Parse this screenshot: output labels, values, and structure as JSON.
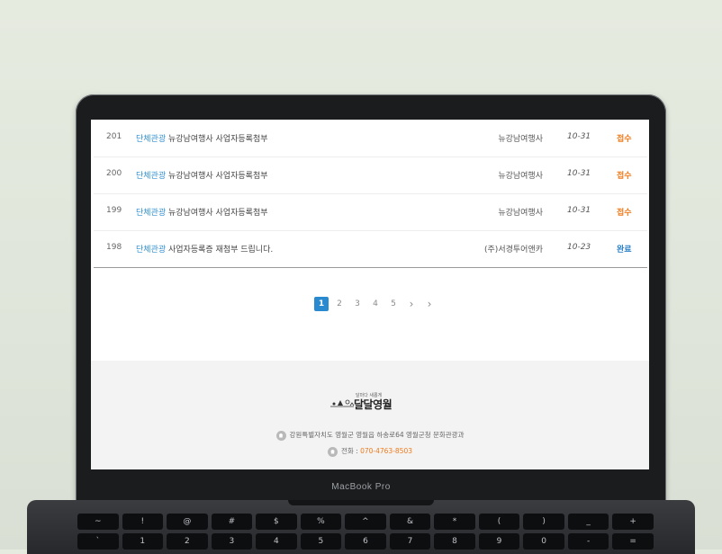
{
  "board": {
    "rows": [
      {
        "num": "201",
        "category": "단체관광",
        "title": "뉴강남여행사 사업자등록첨부",
        "author": "뉴강남여행사",
        "date": "10-31",
        "status": "접수",
        "status_color": "#f07a1a"
      },
      {
        "num": "200",
        "category": "단체관광",
        "title": "뉴강남여행사 사업자등록첨부",
        "author": "뉴강남여행사",
        "date": "10-31",
        "status": "접수",
        "status_color": "#f07a1a"
      },
      {
        "num": "199",
        "category": "단체관광",
        "title": "뉴강남여행사 사업자등록첨부",
        "author": "뉴강남여행사",
        "date": "10-31",
        "status": "접수",
        "status_color": "#f07a1a"
      },
      {
        "num": "198",
        "category": "단체관광",
        "title": "사업자등록증 재첨부 드립니다.",
        "author": "(주)서경투어앤카",
        "date": "10-23",
        "status": "완료",
        "status_color": "#2a7fc7"
      }
    ]
  },
  "pagination": {
    "pages": [
      "1",
      "2",
      "3",
      "4",
      "5"
    ],
    "next": "›",
    "last": "›",
    "current": "1"
  },
  "footer": {
    "logo_small": "달마다 새롭게",
    "logo_text": "달달영월",
    "address": "강원특별자치도 영월군 영월읍 하송로64 영월군청 문화관광과",
    "phone_label": "전화 :",
    "phone_number": "070-4763-8503"
  },
  "device": {
    "brand": "MacBook Pro"
  },
  "keyboard": {
    "row1": [
      "~",
      "!",
      "@",
      "#",
      "$",
      "%",
      "^",
      "&",
      "*",
      "(",
      ")",
      "_",
      "+"
    ],
    "row2": [
      "`",
      "1",
      "2",
      "3",
      "4",
      "5",
      "6",
      "7",
      "8",
      "9",
      "0",
      "-",
      "="
    ]
  },
  "colors": {
    "accent": "#2a8ad0",
    "category": "#2f8fd0",
    "pending": "#f07a1a",
    "done": "#2a7fc7"
  }
}
